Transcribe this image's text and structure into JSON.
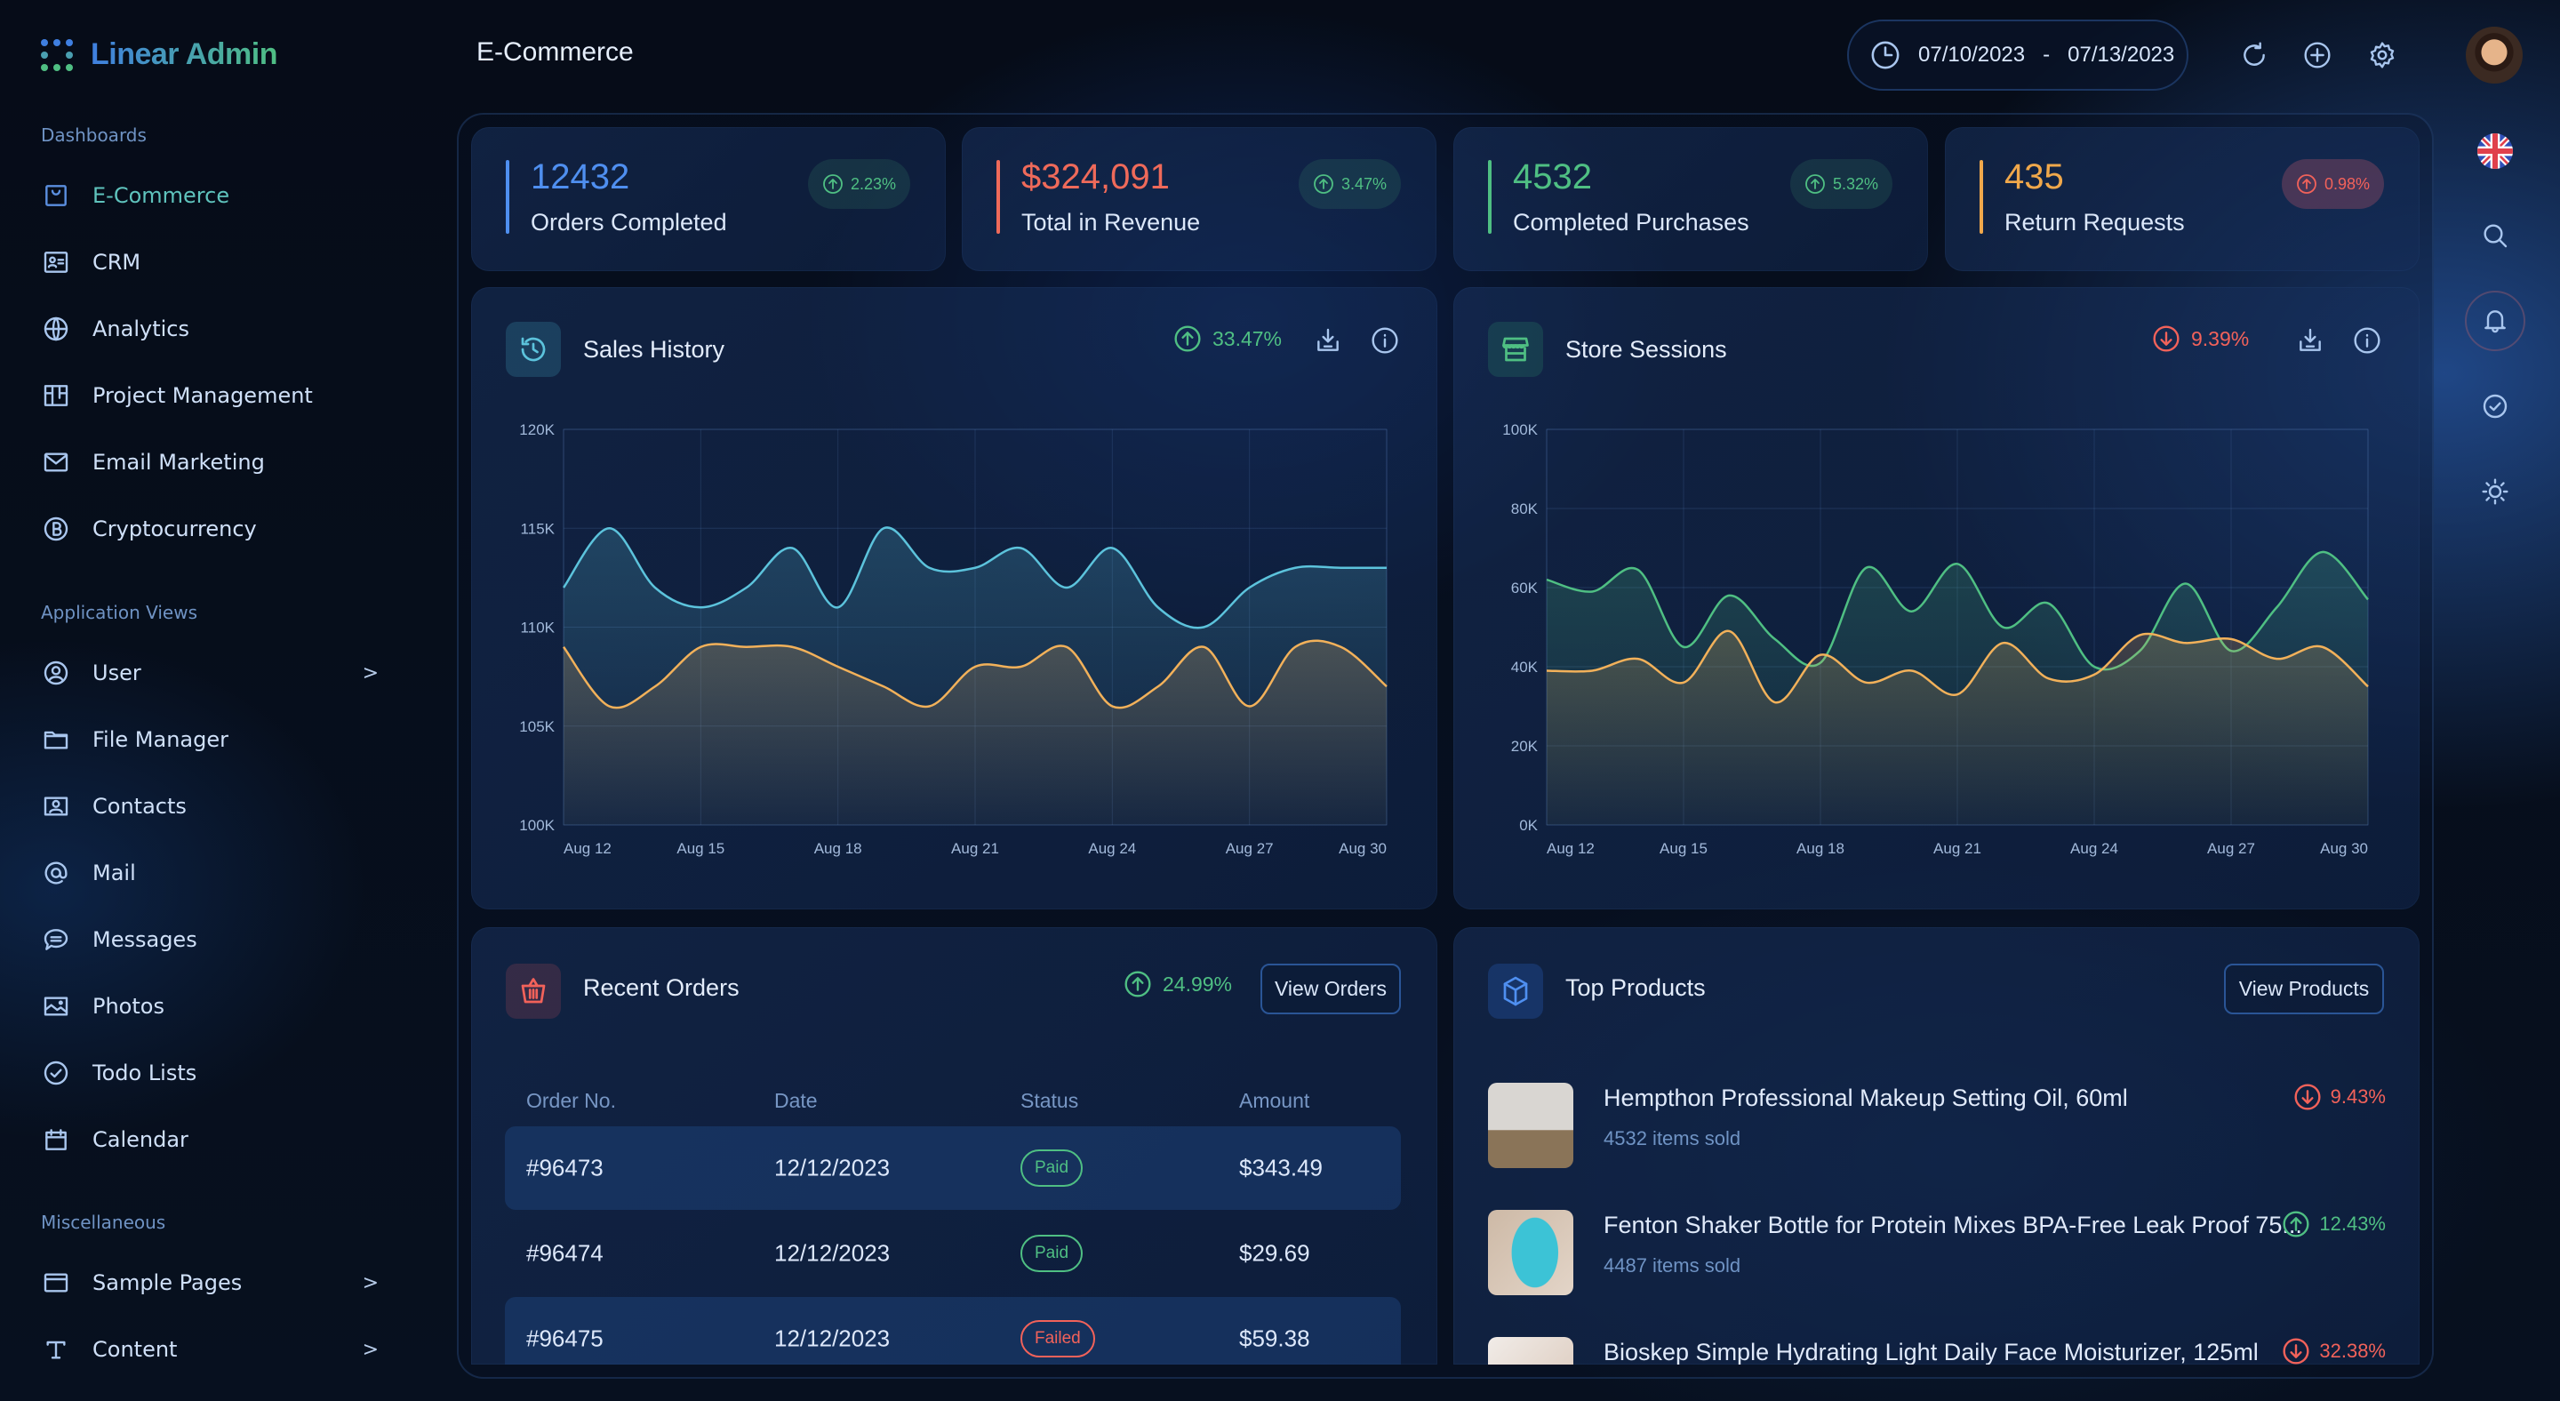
{
  "app": {
    "name": "Linear Admin",
    "page_title": "E-Commerce"
  },
  "colors": {
    "accent": "#4f8ff0",
    "green": "#4fbf83",
    "red": "#f2625a",
    "orange": "#f2b15a",
    "cyan": "#5cc3dc"
  },
  "sidebar": {
    "sections": [
      {
        "title": "Dashboards",
        "items": [
          {
            "label": "E-Commerce",
            "icon": "shopping-bag-icon",
            "active": true
          },
          {
            "label": "CRM",
            "icon": "id-card-icon"
          },
          {
            "label": "Analytics",
            "icon": "globe-icon"
          },
          {
            "label": "Project Management",
            "icon": "kanban-icon"
          },
          {
            "label": "Email Marketing",
            "icon": "envelope-icon"
          },
          {
            "label": "Cryptocurrency",
            "icon": "bitcoin-icon"
          }
        ]
      },
      {
        "title": "Application Views",
        "items": [
          {
            "label": "User",
            "icon": "user-circle-icon",
            "chevron": true
          },
          {
            "label": "File Manager",
            "icon": "folder-icon"
          },
          {
            "label": "Contacts",
            "icon": "contact-card-icon"
          },
          {
            "label": "Mail",
            "icon": "at-sign-icon"
          },
          {
            "label": "Messages",
            "icon": "chat-bubble-icon"
          },
          {
            "label": "Photos",
            "icon": "image-icon"
          },
          {
            "label": "Todo Lists",
            "icon": "check-circle-icon"
          },
          {
            "label": "Calendar",
            "icon": "calendar-icon"
          }
        ]
      },
      {
        "title": "Miscellaneous",
        "items": [
          {
            "label": "Sample Pages",
            "icon": "browser-window-icon",
            "chevron": true
          },
          {
            "label": "Content",
            "icon": "text-type-icon",
            "chevron": true
          }
        ]
      }
    ],
    "chevron": ">"
  },
  "header": {
    "date_start": "07/10/2023",
    "date_sep": "-",
    "date_end": "07/13/2023",
    "icons": [
      "refresh-icon",
      "plus-circle-icon",
      "gear-icon"
    ]
  },
  "rail": {
    "icons": [
      "uk-flag-icon",
      "search-icon",
      "bell-icon",
      "check-circle-icon",
      "sun-icon"
    ]
  },
  "stats": [
    {
      "value": "12432",
      "label": "Orders Completed",
      "delta": "2.23%",
      "dir": "up",
      "color": "#4f8ff0",
      "badge_color": "#4fbf83"
    },
    {
      "value": "$324,091",
      "label": "Total in Revenue",
      "delta": "3.47%",
      "dir": "up",
      "color": "#ef6a5a",
      "badge_color": "#4fbf83"
    },
    {
      "value": "4532",
      "label": "Completed Purchases",
      "delta": "5.32%",
      "dir": "up",
      "color": "#4fbf83",
      "badge_color": "#4fbf83"
    },
    {
      "value": "435",
      "label": "Return Requests",
      "delta": "0.98%",
      "dir": "up",
      "color": "#f0a84b",
      "badge_color": "#f2625a"
    }
  ],
  "chart_data": [
    {
      "type": "area",
      "title": "Sales History",
      "delta": "33.47%",
      "dir": "up",
      "x": [
        "Aug 12",
        "Aug 13",
        "Aug 14",
        "Aug 15",
        "Aug 16",
        "Aug 17",
        "Aug 18",
        "Aug 19",
        "Aug 20",
        "Aug 21",
        "Aug 22",
        "Aug 23",
        "Aug 24",
        "Aug 25",
        "Aug 26",
        "Aug 27",
        "Aug 28",
        "Aug 29",
        "Aug 30"
      ],
      "xticks": [
        "Aug 12",
        "Aug 15",
        "Aug 18",
        "Aug 21",
        "Aug 24",
        "Aug 27",
        "Aug 30"
      ],
      "ylim": [
        100000,
        120000
      ],
      "yticks": [
        100000,
        105000,
        110000,
        115000,
        120000
      ],
      "ytick_labels": [
        "100K",
        "105K",
        "110K",
        "115K",
        "120K"
      ],
      "grid": true,
      "series": [
        {
          "color": "#5cc3dc",
          "values": [
            112000,
            115000,
            112000,
            111000,
            112000,
            114000,
            111000,
            115000,
            113000,
            113000,
            114000,
            112000,
            114000,
            111000,
            110000,
            112000,
            113000,
            113000,
            113000
          ]
        },
        {
          "color": "#f2b15a",
          "values": [
            109000,
            106000,
            107000,
            109000,
            109000,
            109000,
            108000,
            107000,
            106000,
            108000,
            108000,
            109000,
            106000,
            107000,
            109000,
            106000,
            109000,
            109000,
            107000
          ]
        }
      ]
    },
    {
      "type": "area",
      "title": "Store Sessions",
      "delta": "9.39%",
      "dir": "down",
      "x": [
        "Aug 12",
        "Aug 13",
        "Aug 14",
        "Aug 15",
        "Aug 16",
        "Aug 17",
        "Aug 18",
        "Aug 19",
        "Aug 20",
        "Aug 21",
        "Aug 22",
        "Aug 23",
        "Aug 24",
        "Aug 25",
        "Aug 26",
        "Aug 27",
        "Aug 28",
        "Aug 29",
        "Aug 30"
      ],
      "xticks": [
        "Aug 12",
        "Aug 15",
        "Aug 18",
        "Aug 21",
        "Aug 24",
        "Aug 27",
        "Aug 30"
      ],
      "ylim": [
        0,
        100000
      ],
      "yticks": [
        0,
        20000,
        40000,
        60000,
        80000,
        100000
      ],
      "ytick_labels": [
        "0K",
        "20K",
        "40K",
        "60K",
        "80K",
        "100K"
      ],
      "grid": true,
      "series": [
        {
          "color": "#4fbf83",
          "values": [
            62000,
            59000,
            64500,
            45000,
            58000,
            47000,
            41000,
            65000,
            54000,
            66000,
            50000,
            56000,
            40000,
            44000,
            61000,
            44000,
            55000,
            69000,
            57000
          ]
        },
        {
          "color": "#f2b15a",
          "values": [
            39000,
            39000,
            42000,
            36000,
            49000,
            31000,
            43000,
            36000,
            39000,
            33000,
            46000,
            37000,
            38000,
            48000,
            46000,
            47000,
            42000,
            45000,
            35000
          ]
        }
      ]
    }
  ],
  "orders": {
    "title": "Recent Orders",
    "delta": "24.99%",
    "dir": "up",
    "button": "View Orders",
    "columns": [
      "Order No.",
      "Date",
      "Status",
      "Amount"
    ],
    "rows": [
      {
        "no": "#96473",
        "date": "12/12/2023",
        "status": "Paid",
        "amount": "$343.49"
      },
      {
        "no": "#96474",
        "date": "12/12/2023",
        "status": "Paid",
        "amount": "$29.69"
      },
      {
        "no": "#96475",
        "date": "12/12/2023",
        "status": "Failed",
        "amount": "$59.38"
      }
    ]
  },
  "products": {
    "title": "Top Products",
    "button": "View Products",
    "items": [
      {
        "name": "Hempthon Professional Makeup Setting Oil, 60ml",
        "sold": "4532 items sold",
        "delta": "9.43%",
        "dir": "down"
      },
      {
        "name": "Fenton Shaker Bottle for Protein Mixes BPA-Free Leak Proof 75...",
        "sold": "4487 items sold",
        "delta": "12.43%",
        "dir": "up"
      },
      {
        "name": "Bioskep Simple Hydrating Light Daily Face Moisturizer, 125ml",
        "sold": "",
        "delta": "32.38%",
        "dir": "down"
      }
    ]
  }
}
